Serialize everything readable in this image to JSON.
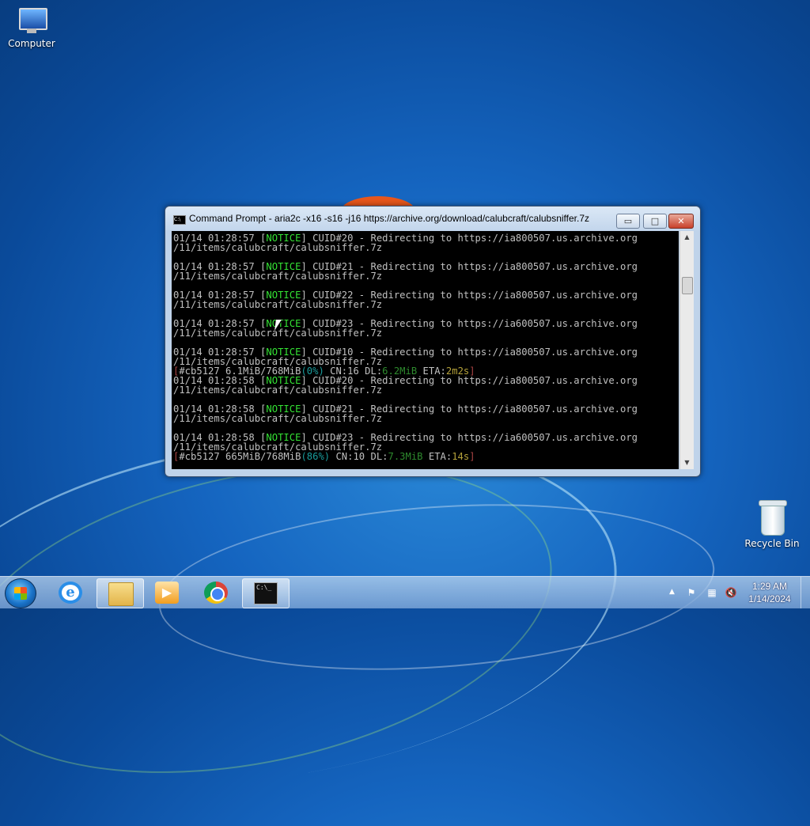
{
  "desktop": {
    "icons": [
      {
        "label": "Computer",
        "icon": "computer-icon"
      },
      {
        "label": "Recycle Bin",
        "icon": "recycle-bin-icon"
      }
    ]
  },
  "window": {
    "title": "Command Prompt - aria2c  -x16 -s16 -j16 https://archive.org/download/calubcraft/calubsniffer.7z",
    "controls": {
      "minimize": "▭",
      "maximize": "□",
      "close": "✕"
    },
    "console_lines": [
      {
        "ts": "01/14 01:28:57",
        "cuid": "CUID#20",
        "host": "ia800507"
      },
      {
        "ts": "01/14 01:28:57",
        "cuid": "CUID#21",
        "host": "ia800507"
      },
      {
        "ts": "01/14 01:28:57",
        "cuid": "CUID#22",
        "host": "ia800507"
      },
      {
        "ts": "01/14 01:28:57",
        "cuid": "CUID#23",
        "host": "ia600507"
      },
      {
        "ts": "01/14 01:28:57",
        "cuid": "CUID#10",
        "host": "ia800507"
      },
      {
        "ts": "01/14 01:28:58",
        "cuid": "CUID#20",
        "host": "ia800507"
      },
      {
        "ts": "01/14 01:28:58",
        "cuid": "CUID#21",
        "host": "ia800507"
      },
      {
        "ts": "01/14 01:28:58",
        "cuid": "CUID#23",
        "host": "ia600507"
      }
    ],
    "notice_label": "NOTICE",
    "redirect_text": "- Redirecting to https://",
    "url_tail": ".us.archive.org",
    "path_line": "/11/items/calubcraft/calubsniffer.7z",
    "progress": [
      {
        "gid": "#cb5127",
        "size": "6.1MiB/768MiB",
        "pct": "0%",
        "cn": "CN:16",
        "dl": "6.2MiB",
        "eta": "2m2s"
      },
      {
        "gid": "#cb5127",
        "size": "665MiB/768MiB",
        "pct": "86%",
        "cn": "CN:10",
        "dl": "7.3MiB",
        "eta": "14s"
      }
    ]
  },
  "taskbar": {
    "apps": [
      {
        "name": "internet-explorer",
        "active": false
      },
      {
        "name": "file-explorer",
        "active": true
      },
      {
        "name": "media-player",
        "active": false
      },
      {
        "name": "chrome",
        "active": false
      },
      {
        "name": "command-prompt",
        "active": true
      }
    ],
    "clock": {
      "time": "1:29 AM",
      "date": "1/14/2024"
    }
  }
}
